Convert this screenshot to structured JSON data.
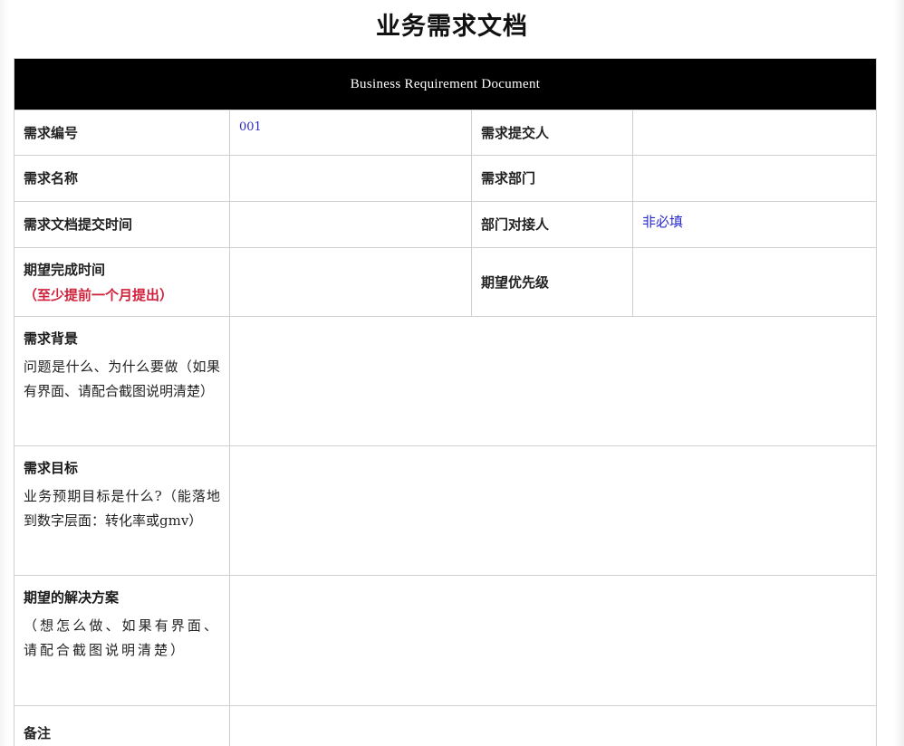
{
  "document": {
    "title": "业务需求文档",
    "banner": "Business Requirement Document"
  },
  "fields": {
    "req_id_label": "需求编号",
    "req_id_value": "001",
    "submitter_label": "需求提交人",
    "req_name_label": "需求名称",
    "department_label": "需求部门",
    "submit_time_label": "需求文档提交时间",
    "dept_contact_label": "部门对接人",
    "dept_contact_value": "非必填",
    "expected_time_label": "期望完成时间",
    "expected_time_note": "（至少提前一个月提出）",
    "priority_label": "期望优先级"
  },
  "sections": {
    "background": {
      "title": "需求背景",
      "description": "问题是什么、为什么要做（如果有界面、请配合截图说明清楚）"
    },
    "goal": {
      "title": "需求目标",
      "description": "业务预期目标是什么?（能落地到数字层面：转化率或gmv）"
    },
    "solution": {
      "title": "期望的解决方案",
      "description": "（想怎么做、如果有界面、请配合截图说明清楚）"
    },
    "remarks": {
      "title": "备注"
    }
  }
}
